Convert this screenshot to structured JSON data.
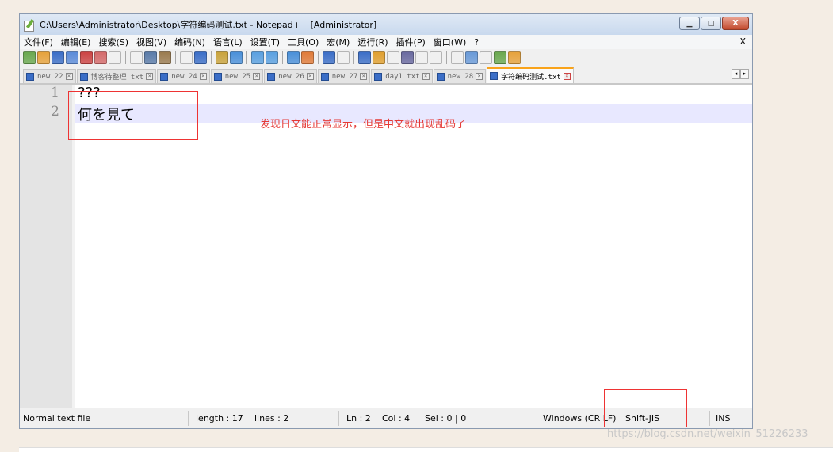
{
  "window": {
    "title": "C:\\Users\\Administrator\\Desktop\\字符编码测试.txt - Notepad++ [Administrator]",
    "controls": {
      "minimize": "▁",
      "maximize": "□",
      "close": "X"
    }
  },
  "menu": {
    "items": [
      "文件(F)",
      "编辑(E)",
      "搜索(S)",
      "视图(V)",
      "编码(N)",
      "语言(L)",
      "设置(T)",
      "工具(O)",
      "宏(M)",
      "运行(R)",
      "插件(P)",
      "窗口(W)",
      "?"
    ],
    "close_label": "X"
  },
  "toolbar": {
    "icons": [
      "new-file-icon",
      "open-file-icon",
      "save-icon",
      "save-all-icon",
      "close-icon",
      "close-all-icon",
      "print-icon",
      "sep",
      "cut-icon",
      "copy-icon",
      "paste-icon",
      "sep",
      "undo-icon",
      "redo-icon",
      "sep",
      "find-icon",
      "replace-icon",
      "sep",
      "zoom-in-icon",
      "zoom-out-icon",
      "sep",
      "sync-vertical-icon",
      "sync-horizontal-icon",
      "sep",
      "word-wrap-icon",
      "show-all-chars-icon",
      "sep",
      "indent-guide-icon",
      "document-map-icon",
      "function-list-icon",
      "folder-as-workspace-icon",
      "monitor-icon",
      "preview-icon",
      "sep",
      "record-macro-icon",
      "stop-record-icon",
      "playback-icon",
      "run-macro-multiple-icon",
      "save-macro-icon"
    ]
  },
  "tabs": [
    {
      "label": "new 22",
      "active": false
    },
    {
      "label": "博客待整理 txt",
      "active": false
    },
    {
      "label": "new 24",
      "active": false
    },
    {
      "label": "new 25",
      "active": false
    },
    {
      "label": "new 26",
      "active": false
    },
    {
      "label": "new 27",
      "active": false
    },
    {
      "label": "day1 txt",
      "active": false
    },
    {
      "label": "new 28",
      "active": false
    },
    {
      "label": "字符编码测试.txt",
      "active": true
    }
  ],
  "tab_close_glyph": "×",
  "tab_scroll": {
    "left": "◂",
    "right": "▸"
  },
  "editor": {
    "lines": [
      {
        "number": "1",
        "text": "???"
      },
      {
        "number": "2",
        "text": "何を見て"
      }
    ],
    "current_line": 2
  },
  "annotation": {
    "note": "发现日文能正常显示，但是中文就出现乱码了"
  },
  "status": {
    "file_type": "Normal text file",
    "length": "length : 17",
    "lines": "lines : 2",
    "ln": "Ln : 2",
    "col": "Col : 4",
    "sel": "Sel : 0 | 0",
    "eol": "Windows (CR LF)",
    "encoding": "Shift-JIS",
    "mode": "INS"
  },
  "watermark": "https://blog.csdn.net/weixin_51226233",
  "colors": {
    "accent": "#f9a31a",
    "annotation": "#e53935",
    "current_line": "#e8e8ff"
  }
}
